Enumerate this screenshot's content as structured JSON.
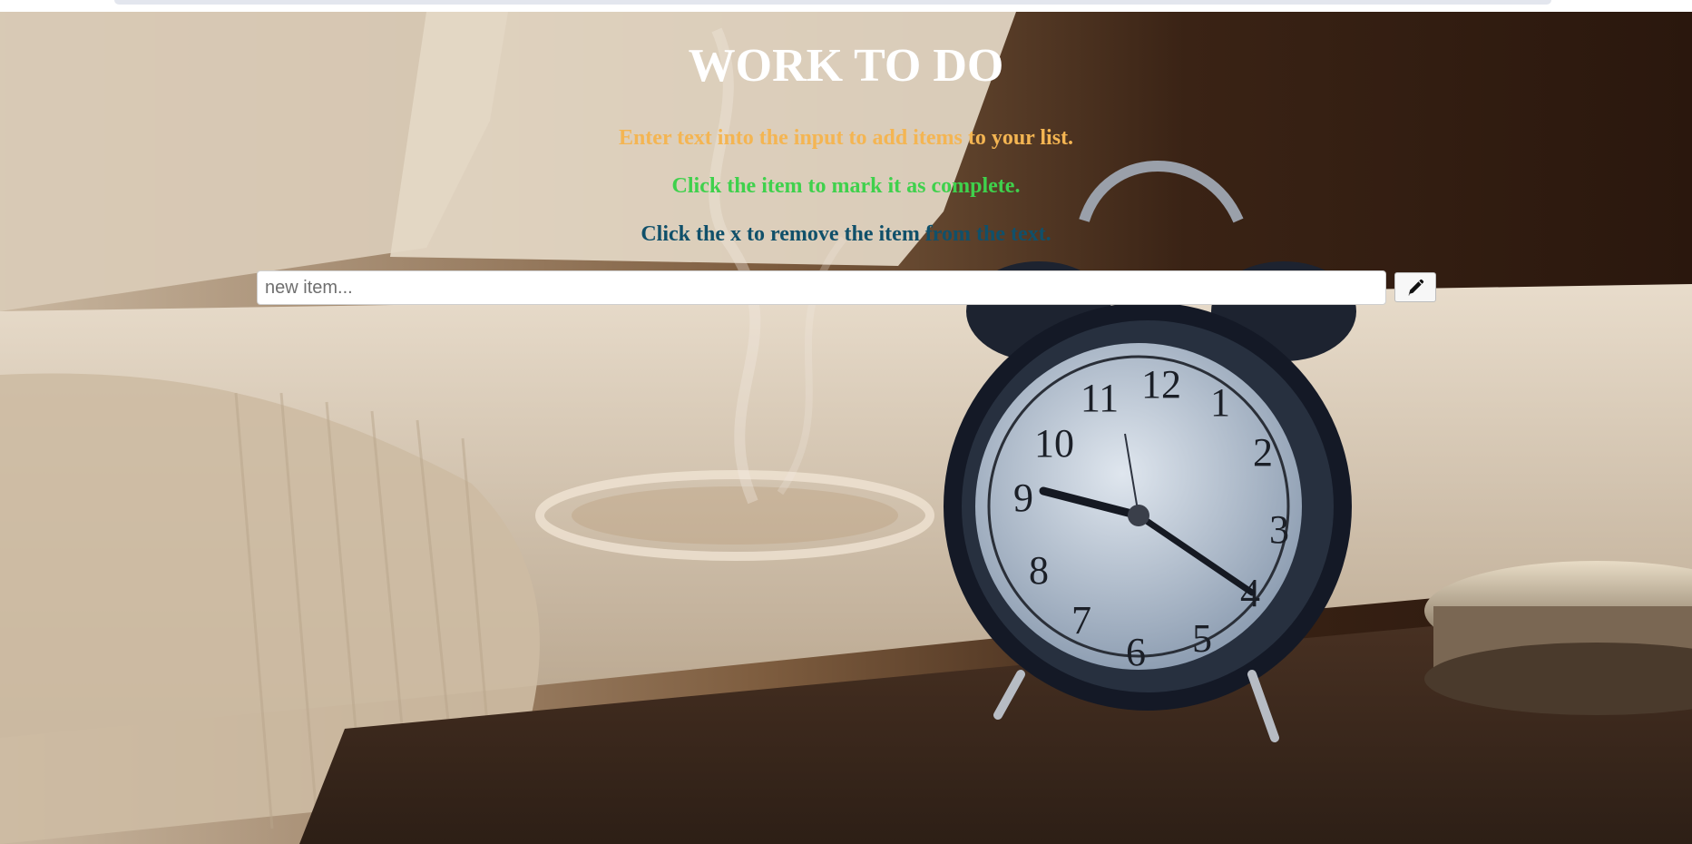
{
  "page": {
    "title": "WORK TO DO",
    "hints": [
      "Enter text into the input to add items to your list.",
      "Click the item to mark it as complete.",
      "Click the x to remove the item from the text."
    ]
  },
  "input": {
    "placeholder": "new item...",
    "value": ""
  },
  "add_button": {
    "icon": "pencil-icon"
  },
  "background": {
    "description_icon": "alarm-clock-photo"
  },
  "colors": {
    "title": "#ffffff",
    "hint_1": "#f4b552",
    "hint_2": "#3fd14c",
    "hint_3": "#10506a"
  }
}
